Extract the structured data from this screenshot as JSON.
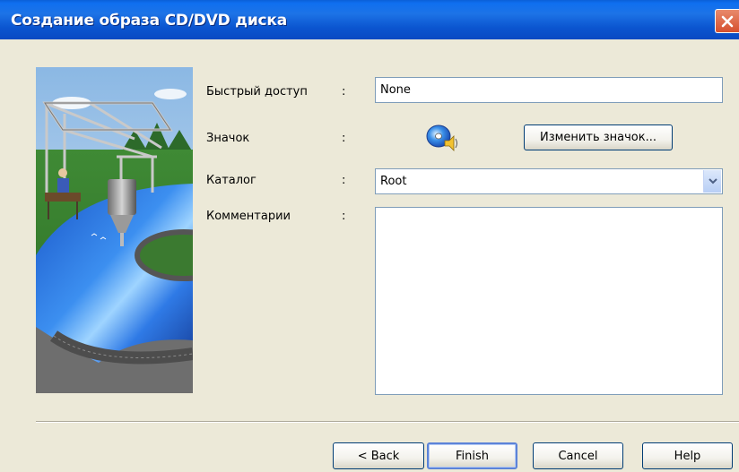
{
  "window": {
    "title": "Создание образа CD/DVD диска"
  },
  "form": {
    "quick_access": {
      "label": "Быстрый доступ",
      "value": "None"
    },
    "icon": {
      "label": "Значок",
      "icon_name": "cd-with-speaker-icon",
      "change_button": "Изменить значок..."
    },
    "catalog": {
      "label": "Каталог",
      "value": "Root"
    },
    "comments": {
      "label": "Комментарии",
      "value": ""
    },
    "separator": ":"
  },
  "buttons": {
    "back": "< Back",
    "finish": "Finish",
    "cancel": "Cancel",
    "help": "Help"
  },
  "colors": {
    "title_bar": "#0b55d0",
    "close_button": "#d6502e",
    "dialog_bg": "#ece9d8",
    "field_border": "#7f9db9"
  }
}
